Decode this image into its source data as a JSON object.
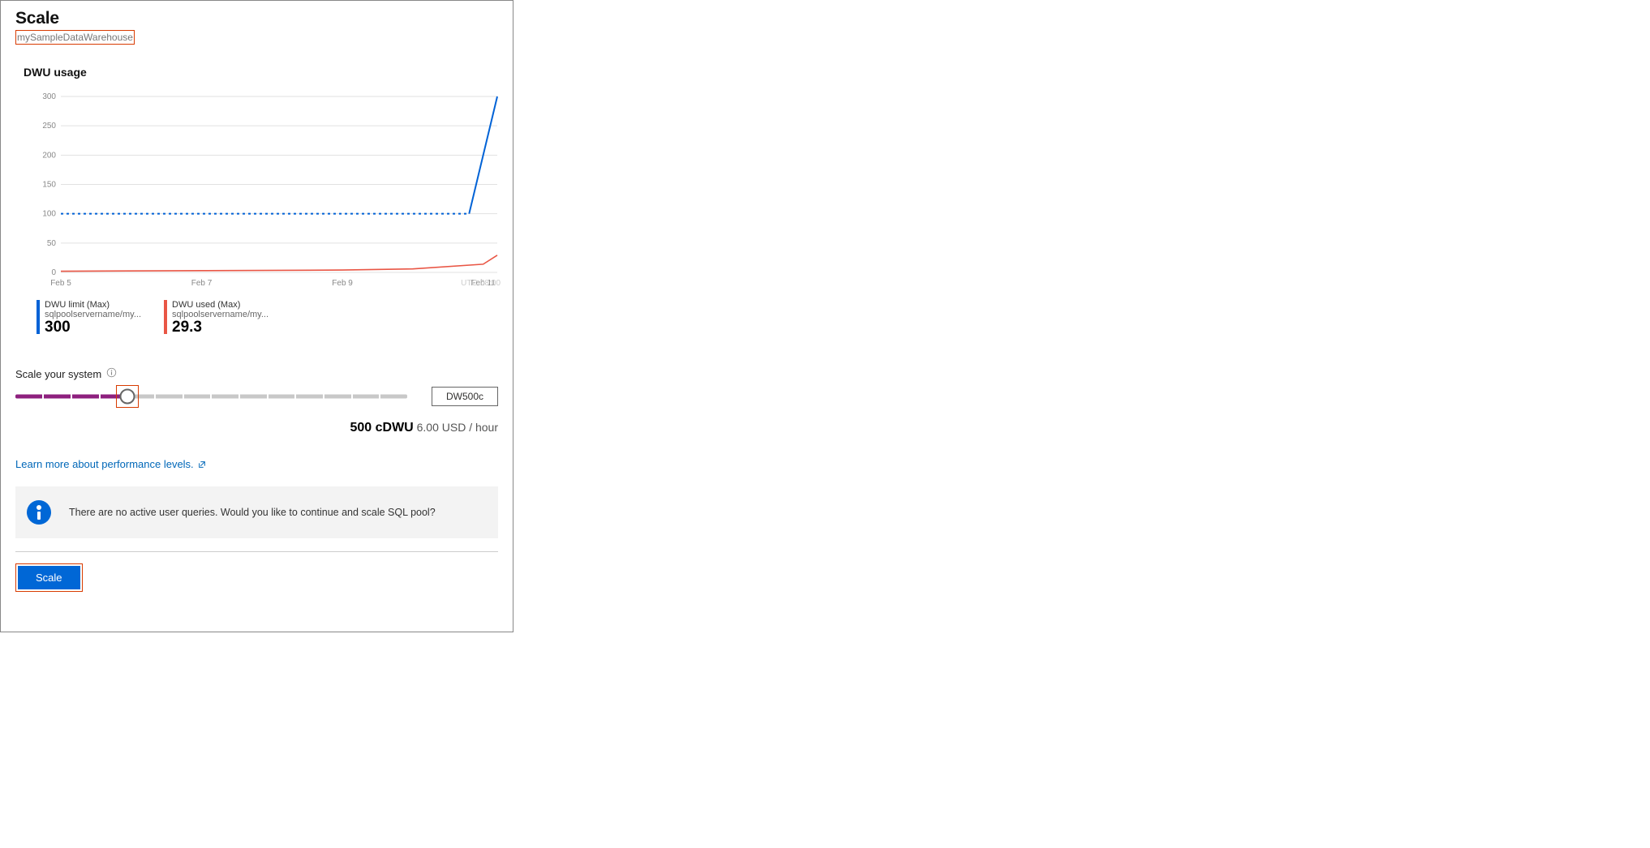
{
  "header": {
    "title": "Scale",
    "subtitle": "mySampleDataWarehouse"
  },
  "usage": {
    "title": "DWU usage"
  },
  "chart_data": {
    "type": "line",
    "xlabel": "",
    "ylabel": "",
    "ylim": [
      0,
      300
    ],
    "yticks": [
      0,
      50,
      100,
      150,
      200,
      250,
      300
    ],
    "xticks": [
      "Feb 5",
      "Feb 7",
      "Feb 9",
      "Feb 11"
    ],
    "timezone": "UTC-08:00",
    "series": [
      {
        "name": "DWU limit (Max)",
        "source": "sqlpoolservername/my...",
        "color": "#0062d6",
        "summary_value": "300",
        "points": [
          {
            "x": "Feb 5",
            "y": 100
          },
          {
            "x": "Feb 7",
            "y": 100
          },
          {
            "x": "Feb 9",
            "y": 100
          },
          {
            "x": "Feb 10.8",
            "y": 100
          },
          {
            "x": "Feb 11.2",
            "y": 300
          }
        ],
        "style_hint": "dotted-then-solid-spike"
      },
      {
        "name": "DWU used (Max)",
        "source": "sqlpoolservername/my...",
        "color": "#e95645",
        "summary_value": "29.3",
        "points": [
          {
            "x": "Feb 5",
            "y": 2
          },
          {
            "x": "Feb 7",
            "y": 3
          },
          {
            "x": "Feb 9",
            "y": 4
          },
          {
            "x": "Feb 10",
            "y": 6
          },
          {
            "x": "Feb 11",
            "y": 14
          },
          {
            "x": "Feb 11.2",
            "y": 29.3
          }
        ]
      }
    ]
  },
  "scale": {
    "label": "Scale your system",
    "value": "DW500c",
    "slider_segments_total": 14,
    "slider_segments_filled": 4,
    "cost_bold": "500 cDWU",
    "cost_light": "6.00 USD / hour"
  },
  "link": {
    "text": "Learn more about performance levels."
  },
  "info_bar": {
    "message": "There are no active user queries. Would you like to continue and scale SQL pool?"
  },
  "button": {
    "label": "Scale"
  }
}
